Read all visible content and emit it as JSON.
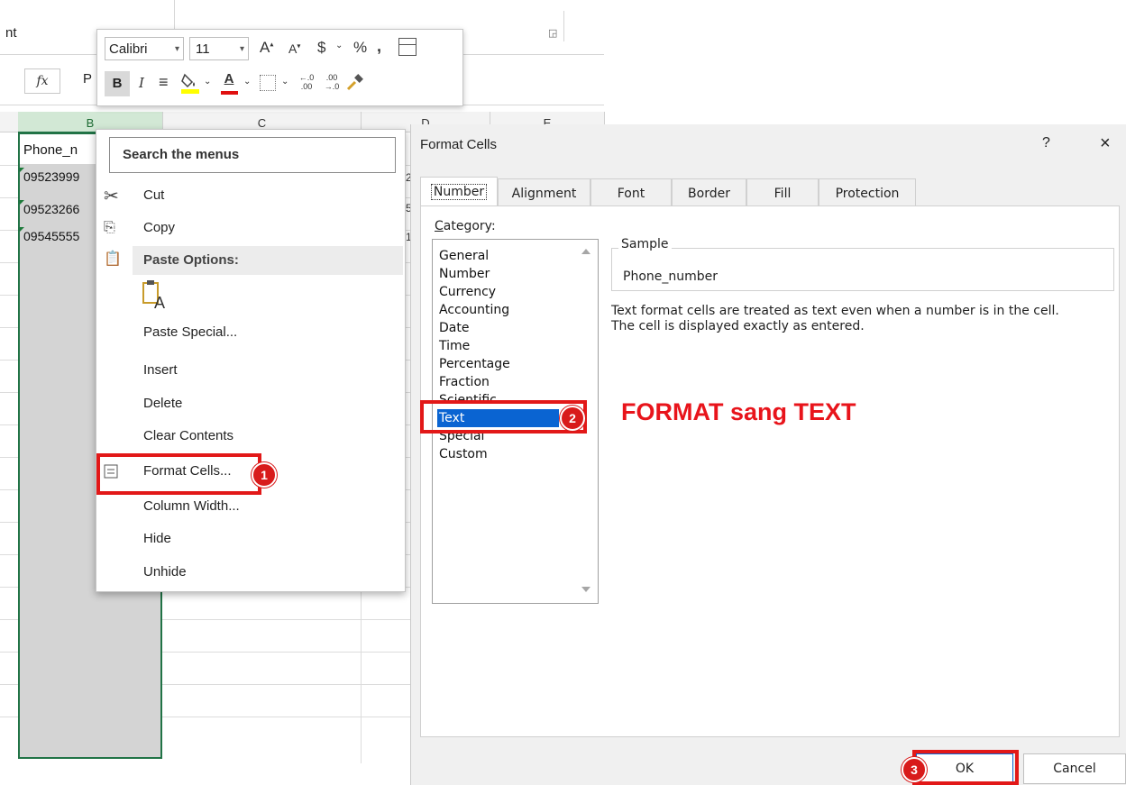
{
  "excel": {
    "ribbon_fragment": "nt",
    "fx_label": "fx",
    "formula_fragment": "P",
    "columns": [
      "B",
      "C",
      "D",
      "E"
    ],
    "cells": [
      "Phone_n",
      "09523999",
      "09523266",
      "09545555"
    ],
    "d_fragments": [
      "2",
      "5",
      "1"
    ]
  },
  "mini_toolbar": {
    "font_name": "Calibri",
    "font_size": "11",
    "grow_font": "A",
    "shrink_font": "A",
    "currency": "$",
    "percent": "%",
    "comma": ",",
    "bold": "B",
    "italic": "I",
    "align": "≡",
    "font_color_letter": "A",
    "inc_decimal": "←.0 .00",
    "dec_decimal": ".00 →.0"
  },
  "context_menu": {
    "search_placeholder": "Search the menus",
    "cut": "Cut",
    "copy": "Copy",
    "paste_options": "Paste Options:",
    "paste_special": "Paste Special...",
    "insert": "Insert",
    "delete": "Delete",
    "clear_contents": "Clear Contents",
    "format_cells": "Format Cells...",
    "column_width": "Column Width...",
    "hide": "Hide",
    "unhide": "Unhide"
  },
  "dialog": {
    "title": "Format Cells",
    "help": "?",
    "close": "×",
    "tabs": [
      "Number",
      "Alignment",
      "Font",
      "Border",
      "Fill",
      "Protection"
    ],
    "active_tab": "Number",
    "category_label": "Category:",
    "categories": [
      "General",
      "Number",
      "Currency",
      "Accounting",
      "Date",
      "Time",
      "Percentage",
      "Fraction",
      "Scientific",
      "Text",
      "Special",
      "Custom"
    ],
    "selected_category": "Text",
    "sample_label": "Sample",
    "sample_value": "Phone_number",
    "description_line1": "Text format cells are treated as text even when a number is in the cell.",
    "description_line2": "The cell is displayed exactly as entered.",
    "ok": "OK",
    "cancel": "Cancel"
  },
  "annotations": {
    "step1": "1",
    "step2": "2",
    "step3": "3",
    "callout": "FORMAT sang TEXT",
    "highlight_color": "#e21818"
  },
  "colors": {
    "excel_green": "#217346",
    "selection_blue": "#0a64d2",
    "annotation_red": "#e21818"
  }
}
